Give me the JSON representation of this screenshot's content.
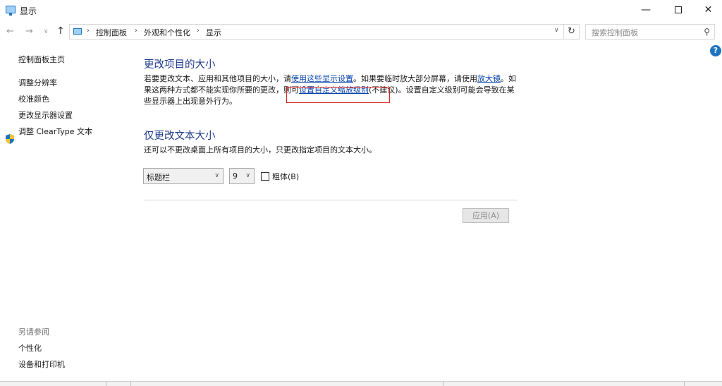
{
  "window": {
    "title": "显示",
    "min_glyph": "—",
    "close_glyph": "✕"
  },
  "nav": {
    "back": "←",
    "forward": "→",
    "recent": "∨",
    "up": "↑"
  },
  "address": {
    "breadcrumbs": [
      "控制面板",
      "外观和个性化",
      "显示"
    ],
    "separator": "›",
    "dropdown": "∨",
    "refresh": "↻"
  },
  "search": {
    "placeholder": "搜索控制面板",
    "icon": "⚲"
  },
  "help": {
    "glyph": "?"
  },
  "sidebar": {
    "home": "控制面板主页",
    "items": [
      "调整分辨率",
      "校准颜色",
      "更改显示器设置",
      "调整 ClearType 文本"
    ],
    "see_also_title": "另请参阅",
    "see_also": [
      "个性化",
      "设备和打印机"
    ]
  },
  "section1": {
    "title": "更改项目的大小",
    "text_a": "若要更改文本、应用和其他项目的大小，请",
    "link_a": "使用这些显示设置",
    "text_b": "。如果要临时放大部分屏幕，请使用",
    "link_b": "放大镜",
    "text_c": "。如果这两种方式都不能实现你所要的更改，则可",
    "link_c": "设置自定义缩放级别",
    "text_d": "(不建议)。设置自定义级别可能会导致在某些显示器上出现意外行为。"
  },
  "section2": {
    "title": "仅更改文本大小",
    "description": "还可以不更改桌面上所有项目的大小，只更改指定项目的文本大小。",
    "item_select": "标题栏",
    "size_select": "9",
    "bold_label": "粗体(B)",
    "apply_label": "应用(A)"
  },
  "colors": {
    "accent": "#1e73be",
    "heading": "#1e3a8a",
    "link": "#0645ad",
    "highlight": "#e02020"
  }
}
